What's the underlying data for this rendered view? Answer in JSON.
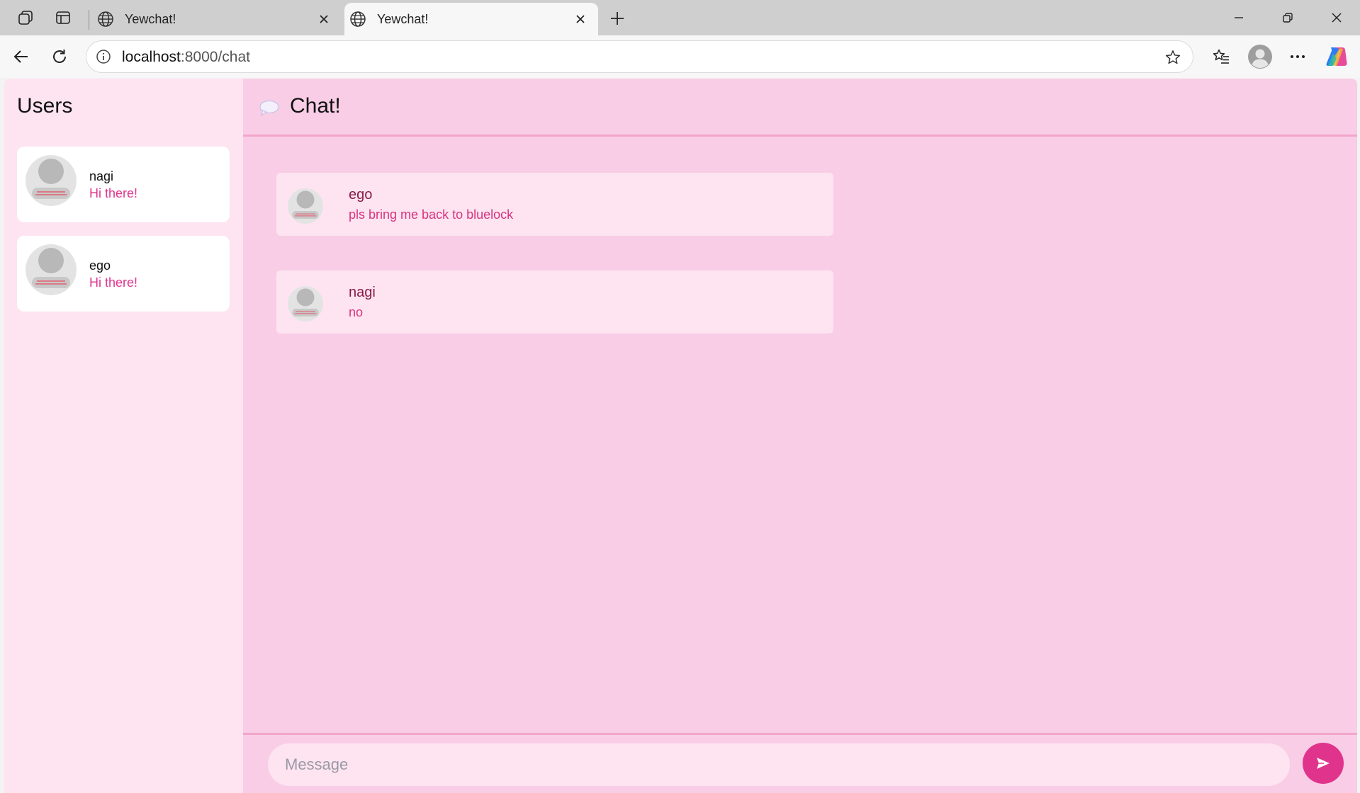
{
  "browser": {
    "tabs": [
      {
        "title": "Yewchat!",
        "icon": "globe-icon"
      },
      {
        "title": "Yewchat!",
        "icon": "globe-icon",
        "active": true
      }
    ],
    "url_host": "localhost",
    "url_path": ":8000/chat"
  },
  "sidebar": {
    "title": "Users",
    "users": [
      {
        "name": "nagi",
        "last_message": "Hi there!"
      },
      {
        "name": "ego",
        "last_message": "Hi there!"
      }
    ]
  },
  "chat": {
    "title": "Chat!",
    "messages": [
      {
        "from": "ego",
        "text": "pls bring me back to bluelock"
      },
      {
        "from": "nagi",
        "text": "no"
      }
    ]
  },
  "compose": {
    "placeholder": "Message"
  },
  "colors": {
    "accent": "#e0348c",
    "chat_bg": "#f9cde6",
    "sidebar_bg": "#fde4f0",
    "message_card": "#fde4f0"
  }
}
